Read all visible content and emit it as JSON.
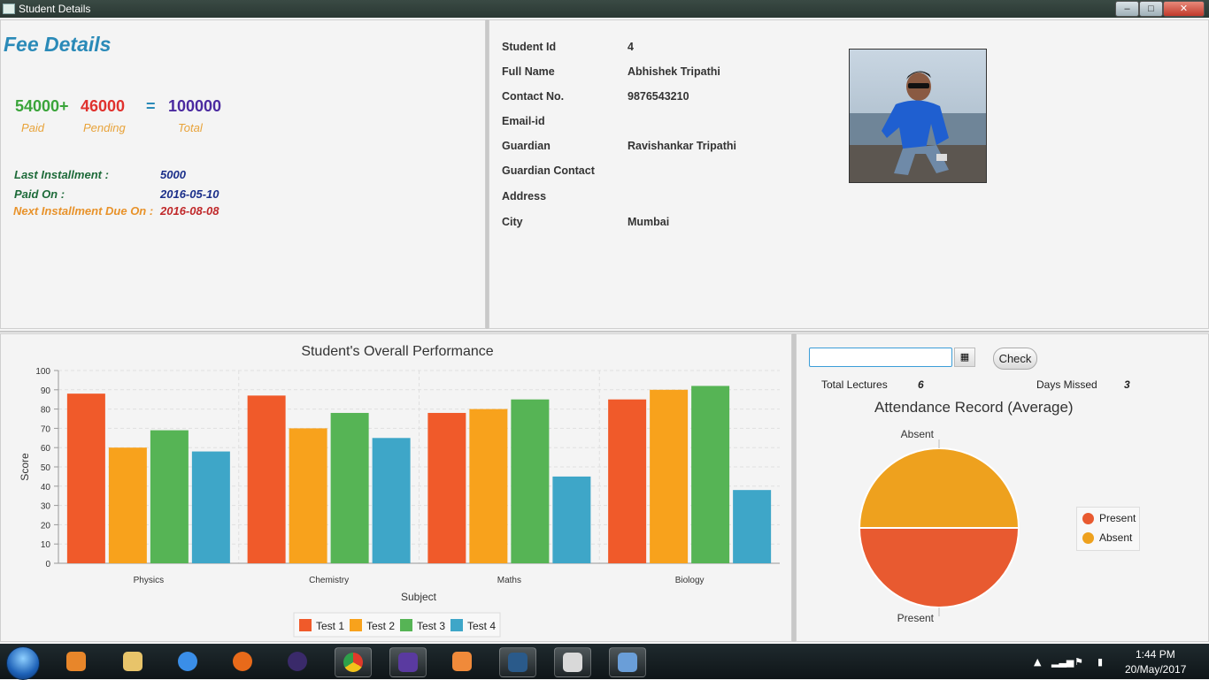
{
  "window": {
    "title": "Student Details",
    "minimize": "–",
    "maximize": "□",
    "close": "✕"
  },
  "fee": {
    "title": "Fee Details",
    "paid": "54000+",
    "pending": "46000",
    "equals": "=",
    "total": "100000",
    "paid_caption": "Paid",
    "pending_caption": "Pending",
    "total_caption": "Total",
    "last_installment_label": "Last Installment :",
    "last_installment_value": "5000",
    "paid_on_label": "Paid On :",
    "paid_on_value": "2016-05-10",
    "next_due_label": "Next Installment Due On :",
    "next_due_value": "2016-08-08",
    "colors": {
      "paid": "#3aa43a",
      "pending": "#e0322e",
      "total": "#4b2aa0",
      "equals": "#2a8ab8",
      "labels": "#1e6b3a",
      "values": "#1b2f8a",
      "next_label": "#e8922a",
      "next_value": "#c0282a"
    }
  },
  "student": {
    "fields": [
      {
        "label": "Student Id",
        "value": "4"
      },
      {
        "label": "Full Name",
        "value": "Abhishek Tripathi"
      },
      {
        "label": "Contact No.",
        "value": "9876543210"
      },
      {
        "label": "Email-id",
        "value": ""
      },
      {
        "label": "Guardian",
        "value": "Ravishankar Tripathi"
      },
      {
        "label": "Guardian Contact",
        "value": ""
      },
      {
        "label": "Address",
        "value": ""
      },
      {
        "label": "City",
        "value": "Mumbai"
      }
    ]
  },
  "chart_data": {
    "type": "bar",
    "title": "Student's Overall Performance",
    "xlabel": "Subject",
    "ylabel": "Score",
    "categories": [
      "Physics",
      "Chemistry",
      "Maths",
      "Biology"
    ],
    "ylim": [
      0,
      100
    ],
    "yticks": [
      0,
      10,
      20,
      30,
      40,
      50,
      60,
      70,
      80,
      90,
      100
    ],
    "grid": true,
    "legend_position": "bottom",
    "series": [
      {
        "name": "Test 1",
        "color": "#f05a2a",
        "values": [
          88,
          87,
          78,
          85
        ]
      },
      {
        "name": "Test 2",
        "color": "#f8a21c",
        "values": [
          60,
          70,
          80,
          90
        ]
      },
      {
        "name": "Test 3",
        "color": "#56b455",
        "values": [
          69,
          78,
          85,
          92
        ]
      },
      {
        "name": "Test 4",
        "color": "#3ea6c8",
        "values": [
          58,
          65,
          45,
          38
        ]
      }
    ]
  },
  "attendance": {
    "date_value": "",
    "calendar_icon": "▦",
    "check_label": "Check",
    "total_lectures_label": "Total Lectures",
    "total_lectures_value": "6",
    "days_missed_label": "Days Missed",
    "days_missed_value": "3",
    "pie_title": "Attendance Record (Average)",
    "pie": [
      {
        "name": "Present",
        "value": 3,
        "color": "#e85a30"
      },
      {
        "name": "Absent",
        "value": 3,
        "color": "#eea11e"
      }
    ]
  },
  "taskbar": {
    "time": "1:44 PM",
    "date": "20/May/2017"
  }
}
